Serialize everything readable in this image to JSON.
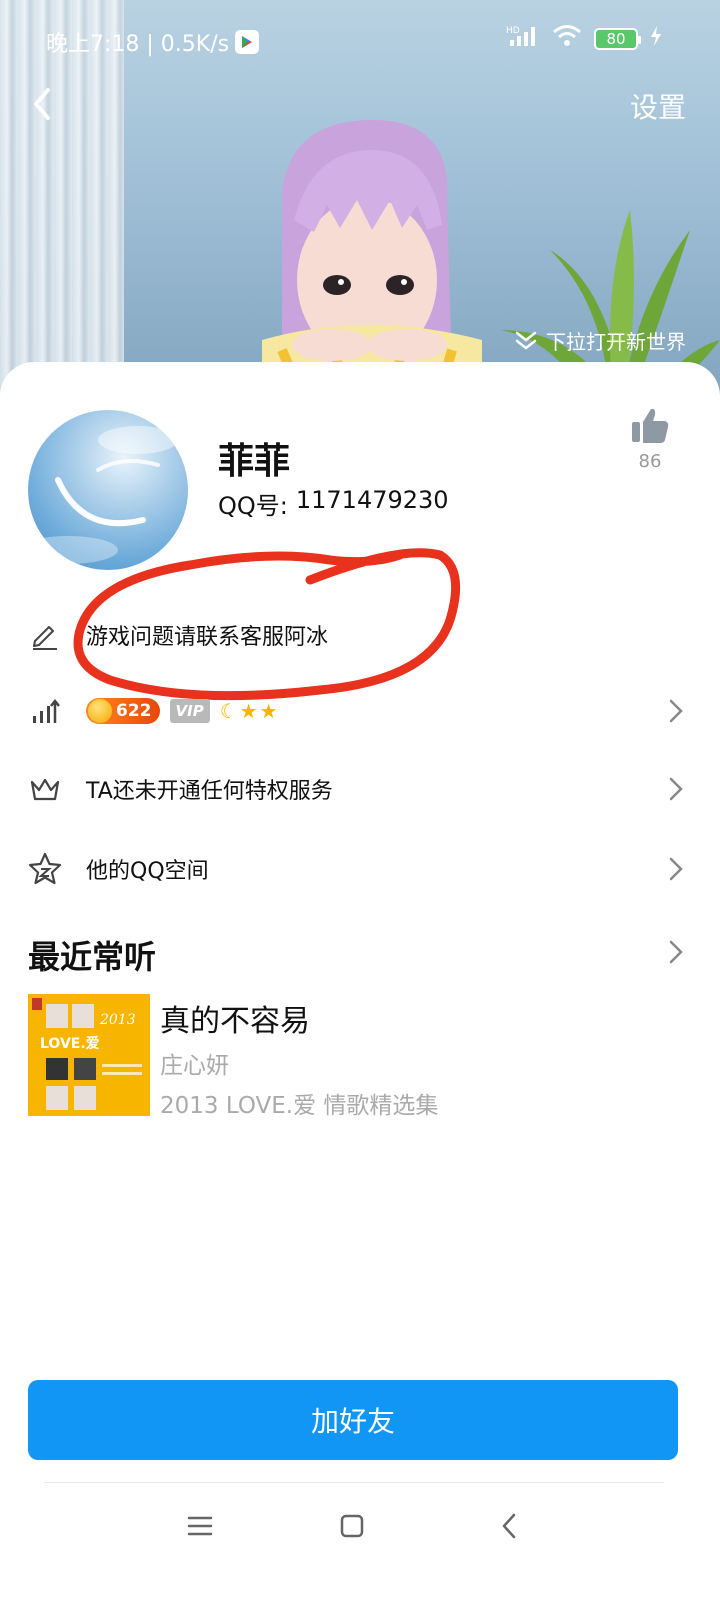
{
  "status_bar": {
    "time_speed": "晚上7:18 | 0.5K/s",
    "network": "HD",
    "battery": "80"
  },
  "header": {
    "settings_label": "设置",
    "pull_hint": "下拉打开新世界"
  },
  "profile": {
    "nickname": "菲菲",
    "qq_label": "QQ号:",
    "qq_number": "1171479230",
    "likes": "86"
  },
  "rows": {
    "signature": "游戏问题请联系客服阿冰",
    "level_number": "622",
    "vip_label": "VIP",
    "privilege": "TA还未开通任何特权服务",
    "qzone": "他的QQ空间"
  },
  "music": {
    "section_title": "最近常听",
    "song_title": "真的不容易",
    "artist": "庄心妍",
    "album": "2013 LOVE.爱 情歌精选集",
    "cover_text_year": "2013",
    "cover_text_love": "LOVE.爱"
  },
  "actions": {
    "add_friend": "加好友"
  },
  "colors": {
    "primary": "#1296f6",
    "annotation": "#e8321e",
    "muted": "#aaaaaa",
    "level_badge": "#e8470a"
  }
}
